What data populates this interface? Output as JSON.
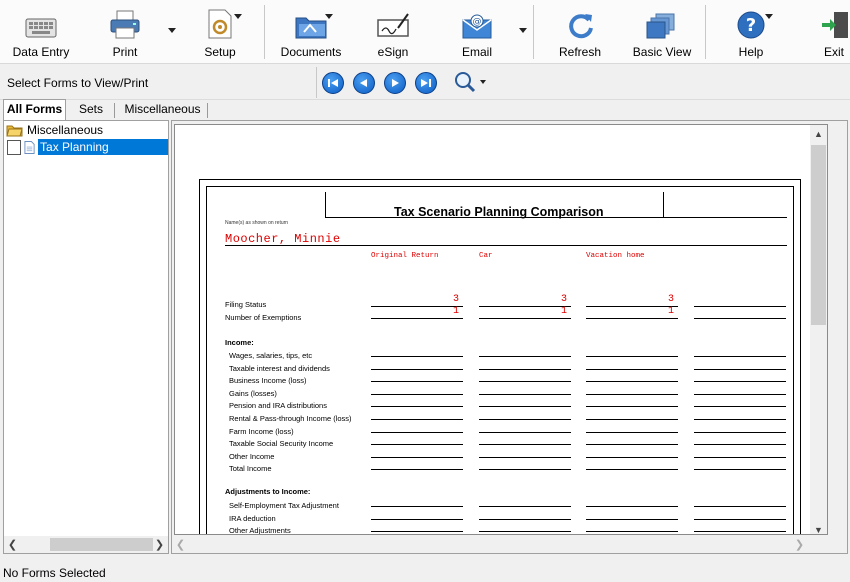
{
  "toolbar": {
    "data_entry": "Data Entry",
    "print": "Print",
    "setup": "Setup",
    "documents": "Documents",
    "esign": "eSign",
    "email": "Email",
    "refresh": "Refresh",
    "basic_view": "Basic View",
    "help": "Help",
    "exit": "Exit"
  },
  "nav": {
    "title": "Select Forms to View/Print"
  },
  "tabs": [
    "All Forms",
    "Sets",
    "Miscellaneous"
  ],
  "tree": {
    "root": "Miscellaneous",
    "child": "Tax Planning Comparison"
  },
  "form": {
    "title": "Tax Scenario Planning Comparison",
    "name_caption": "Name(s) as shown on return",
    "taxpayer": "Moocher, Minnie",
    "columns": [
      "Original Return",
      "Car",
      "Vacation home"
    ],
    "rows_top": [
      {
        "label": "Filing Status",
        "values": [
          "3",
          "3",
          "3"
        ]
      },
      {
        "label": "Number of Exemptions",
        "values": [
          "1",
          "1",
          "1"
        ]
      }
    ],
    "income_heading": "Income:",
    "income_rows": [
      "Wages, salaries, tips, etc",
      "Taxable interest and dividends",
      "Business Income (loss)",
      "Gains (losses)",
      "Pension and IRA distributions",
      "Rental & Pass-through Income (loss)",
      "Farm Income (loss)",
      "Taxable Social Security Income",
      "Other Income",
      "Total Income"
    ],
    "adjust_heading": "Adjustments to Income:",
    "adjust_rows": [
      "Self-Employment Tax Adjustment",
      "IRA deduction",
      "Other Adjustments"
    ]
  },
  "status": "No Forms Selected"
}
